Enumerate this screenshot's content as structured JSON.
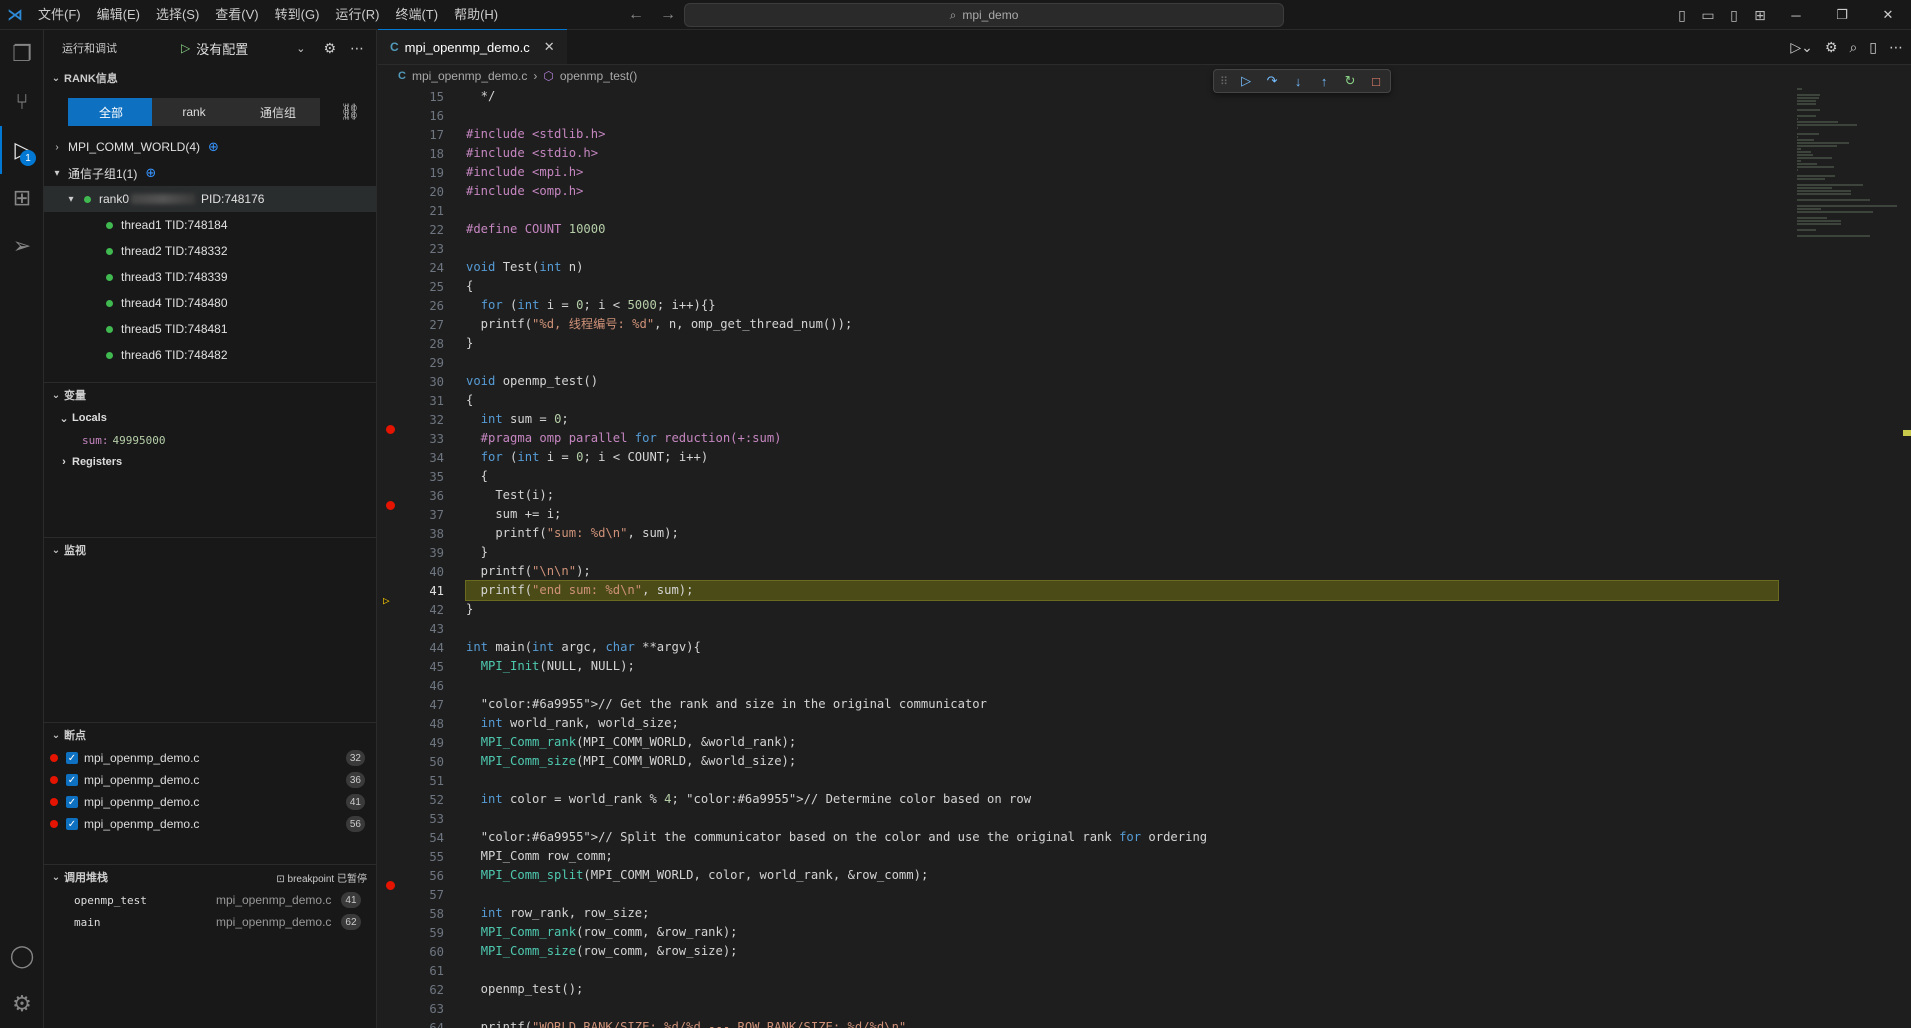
{
  "titlebar": {
    "logo": "vscode-logo",
    "menus": [
      "文件(F)",
      "编辑(E)",
      "选择(S)",
      "查看(V)",
      "转到(G)",
      "运行(R)",
      "终端(T)",
      "帮助(H)"
    ],
    "search": "mpi_demo"
  },
  "sidebar": {
    "header_title": "运行和调试",
    "run_config": "没有配置",
    "rank_section": {
      "title": "RANK信息",
      "tabs": [
        "全部",
        "rank",
        "通信组"
      ],
      "comm_world": "MPI_COMM_WORLD(4)",
      "comm_group": "通信子组1(1)",
      "rank_label": "rank0",
      "pid": "PID:748176",
      "threads": [
        "thread1 TID:748184",
        "thread2 TID:748332",
        "thread3 TID:748339",
        "thread4 TID:748480",
        "thread5 TID:748481",
        "thread6 TID:748482"
      ]
    },
    "variables": {
      "title": "变量",
      "locals": "Locals",
      "var_name": "sum:",
      "var_value": "49995000",
      "registers": "Registers"
    },
    "watch": {
      "title": "监视"
    },
    "breakpoints": {
      "title": "断点",
      "items": [
        {
          "file": "mpi_openmp_demo.c",
          "line": "32"
        },
        {
          "file": "mpi_openmp_demo.c",
          "line": "36"
        },
        {
          "file": "mpi_openmp_demo.c",
          "line": "41"
        },
        {
          "file": "mpi_openmp_demo.c",
          "line": "56"
        }
      ]
    },
    "callstack": {
      "title": "调用堆栈",
      "status": "breakpoint 已暂停",
      "frames": [
        {
          "fn": "openmp_test",
          "file": "mpi_openmp_demo.c",
          "line": "41"
        },
        {
          "fn": "main",
          "file": "mpi_openmp_demo.c",
          "line": "62"
        }
      ]
    }
  },
  "editor": {
    "tab": "mpi_openmp_demo.c",
    "breadcrumb": {
      "file": "mpi_openmp_demo.c",
      "symbol": "openmp_test()"
    },
    "current_line": "41",
    "breakpoint_lines": [
      "32",
      "36",
      "41",
      "56"
    ],
    "lines": [
      {
        "n": "15",
        "t": "  */"
      },
      {
        "n": "16",
        "t": ""
      },
      {
        "n": "17",
        "t": "#include <stdlib.h>"
      },
      {
        "n": "18",
        "t": "#include <stdio.h>"
      },
      {
        "n": "19",
        "t": "#include <mpi.h>"
      },
      {
        "n": "20",
        "t": "#include <omp.h>"
      },
      {
        "n": "21",
        "t": ""
      },
      {
        "n": "22",
        "t": "#define COUNT 10000"
      },
      {
        "n": "23",
        "t": ""
      },
      {
        "n": "24",
        "t": "void Test(int n)"
      },
      {
        "n": "25",
        "t": "{"
      },
      {
        "n": "26",
        "t": "  for (int i = 0; i < 5000; i++){}"
      },
      {
        "n": "27",
        "t": "  printf(\"%d, 线程编号: %d\", n, omp_get_thread_num());"
      },
      {
        "n": "28",
        "t": "}"
      },
      {
        "n": "29",
        "t": ""
      },
      {
        "n": "30",
        "t": "void openmp_test()"
      },
      {
        "n": "31",
        "t": "{"
      },
      {
        "n": "32",
        "t": "  int sum = 0;"
      },
      {
        "n": "33",
        "t": "  #pragma omp parallel for reduction(+:sum)"
      },
      {
        "n": "34",
        "t": "  for (int i = 0; i < COUNT; i++)"
      },
      {
        "n": "35",
        "t": "  {"
      },
      {
        "n": "36",
        "t": "    Test(i);"
      },
      {
        "n": "37",
        "t": "    sum += i;"
      },
      {
        "n": "38",
        "t": "    printf(\"sum: %d\\n\", sum);"
      },
      {
        "n": "39",
        "t": "  }"
      },
      {
        "n": "40",
        "t": "  printf(\"\\n\\n\");"
      },
      {
        "n": "41",
        "t": "  printf(\"end sum: %d\\n\", sum);"
      },
      {
        "n": "42",
        "t": "}"
      },
      {
        "n": "43",
        "t": ""
      },
      {
        "n": "44",
        "t": "int main(int argc, char **argv){"
      },
      {
        "n": "45",
        "t": "  MPI_Init(NULL, NULL);"
      },
      {
        "n": "46",
        "t": ""
      },
      {
        "n": "47",
        "t": "  // Get the rank and size in the original communicator"
      },
      {
        "n": "48",
        "t": "  int world_rank, world_size;"
      },
      {
        "n": "49",
        "t": "  MPI_Comm_rank(MPI_COMM_WORLD, &world_rank);"
      },
      {
        "n": "50",
        "t": "  MPI_Comm_size(MPI_COMM_WORLD, &world_size);"
      },
      {
        "n": "51",
        "t": ""
      },
      {
        "n": "52",
        "t": "  int color = world_rank % 4; // Determine color based on row"
      },
      {
        "n": "53",
        "t": ""
      },
      {
        "n": "54",
        "t": "  // Split the communicator based on the color and use the original rank for ordering"
      },
      {
        "n": "55",
        "t": "  MPI_Comm row_comm;"
      },
      {
        "n": "56",
        "t": "  MPI_Comm_split(MPI_COMM_WORLD, color, world_rank, &row_comm);"
      },
      {
        "n": "57",
        "t": ""
      },
      {
        "n": "58",
        "t": "  int row_rank, row_size;"
      },
      {
        "n": "59",
        "t": "  MPI_Comm_rank(row_comm, &row_rank);"
      },
      {
        "n": "60",
        "t": "  MPI_Comm_size(row_comm, &row_size);"
      },
      {
        "n": "61",
        "t": ""
      },
      {
        "n": "62",
        "t": "  openmp_test();"
      },
      {
        "n": "63",
        "t": ""
      },
      {
        "n": "64",
        "t": "  printf(\"WORLD RANK/SIZE: %d/%d --- ROW RANK/SIZE: %d/%d\\n\","
      }
    ]
  },
  "colors": {
    "accent": "#0078d4",
    "breakpoint": "#e51400",
    "current_line_bg": "#4b4b18",
    "thread_status": "#3fb950"
  }
}
